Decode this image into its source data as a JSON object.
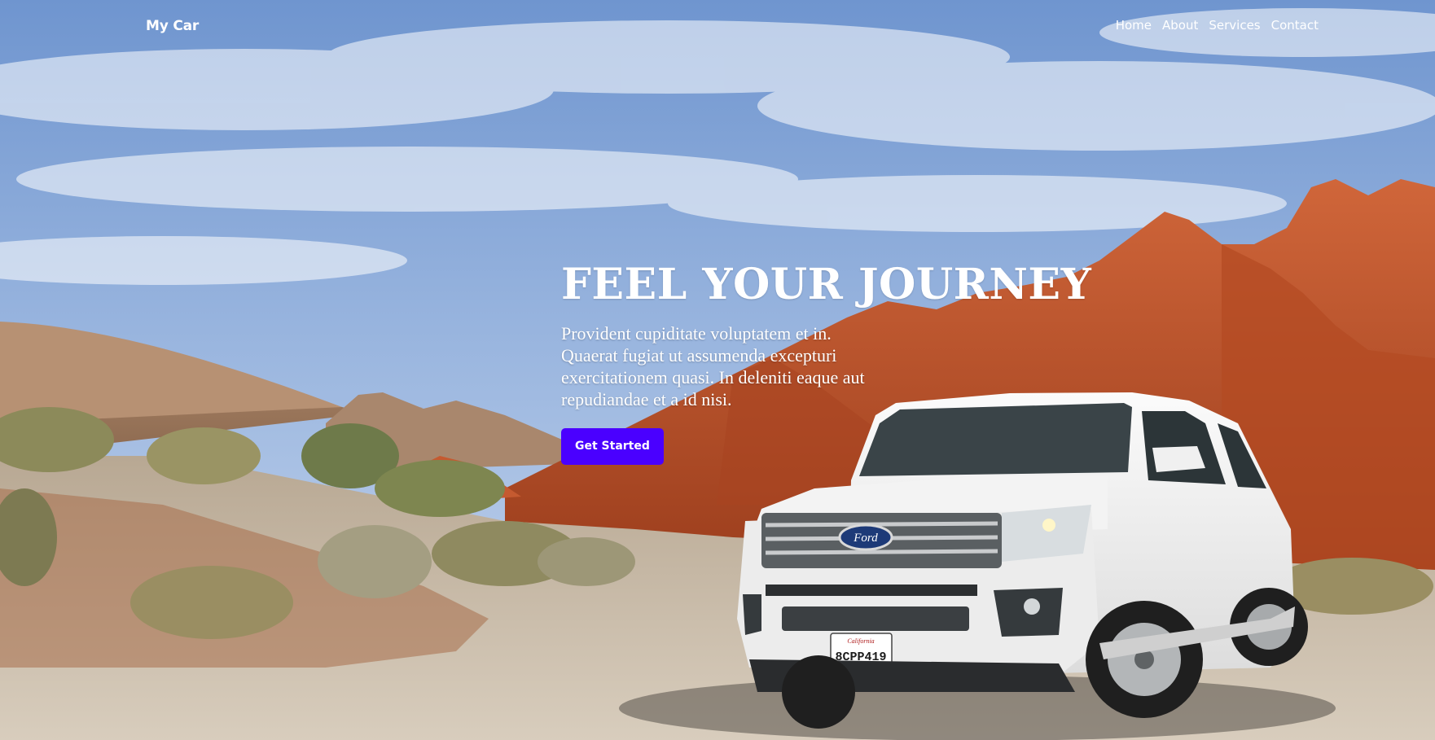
{
  "nav": {
    "logo": "My Car",
    "links": [
      "Home",
      "About",
      "Services",
      "Contact"
    ]
  },
  "hero": {
    "headline": "FEEL YOUR JOURNEY",
    "text": "Provident cupiditate voluptatem et in. Quaerat fugiat ut assumenda excepturi exercitationem quasi. In deleniti eaque aut repudiandae et a id nisi.",
    "button_label": "Get Started",
    "license_plate": "8CPP419",
    "brand_badge": "Ford"
  },
  "colors": {
    "accent": "#4a00ff",
    "text": "#ffffff",
    "sky": "#7fa4d8",
    "rock": "#c5542a"
  }
}
